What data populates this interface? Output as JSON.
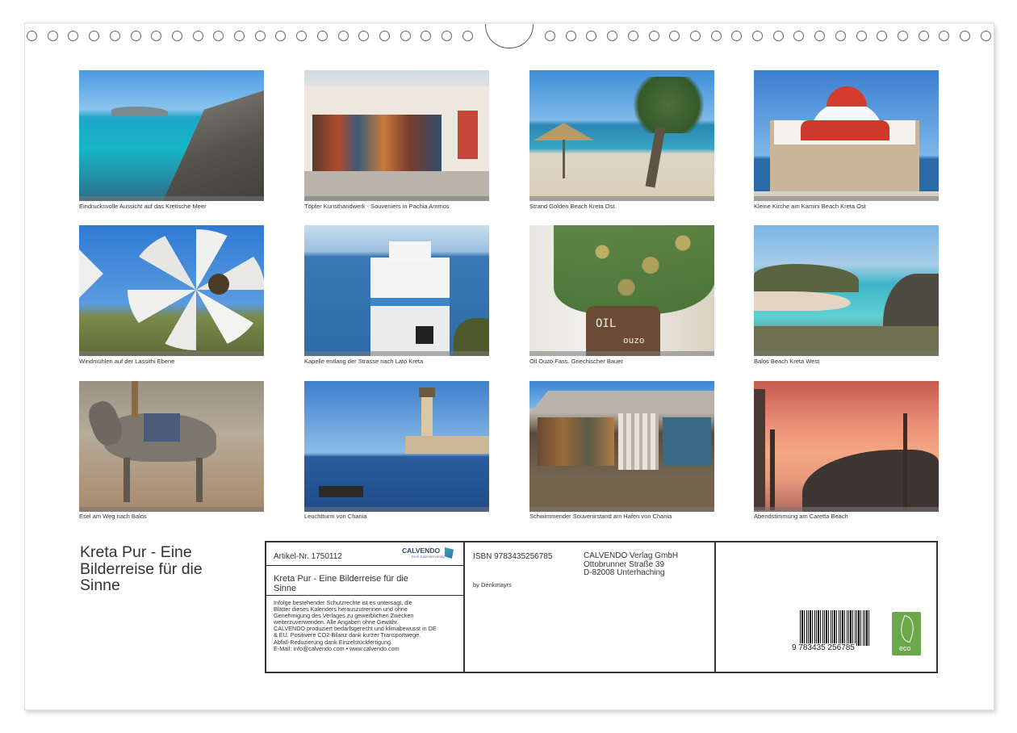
{
  "photos": [
    {
      "caption": "Eindrucksvolle Aussicht auf das Kretische Meer"
    },
    {
      "caption": "Töpfer Kunsthandwerk - Souveniers in Pachia Ammos"
    },
    {
      "caption": "Strand Golden Beach Kreta Ost"
    },
    {
      "caption": "Kleine Kirche am Kamini Beach Kreta Ost"
    },
    {
      "caption": "Windmühlen auf der Lassithi Ebene"
    },
    {
      "caption": "Kapelle entlang der Strasse nach Lato Kreta"
    },
    {
      "caption": "Oil Ouzo Fass. Griechischer Bauer",
      "sign_line1": "OIL",
      "sign_line2": "ouzo"
    },
    {
      "caption": "Balos Beach Kreta West"
    },
    {
      "caption": "Esel am Weg nach Balos"
    },
    {
      "caption": "Leuchtturm von Chania"
    },
    {
      "caption": "Schwimmender Souvenirstand am Hafen von Chania"
    },
    {
      "caption": "Abendstimmung am Caretta Beach"
    }
  ],
  "title": {
    "line1": "Kreta Pur - Eine",
    "line2": "Bilderreise für die",
    "line3": "Sinne"
  },
  "info": {
    "article_no": "Artikel-Nr. 1750112",
    "brand": "CALVENDO",
    "brand_sub": "Dein Kalenderverlag",
    "product_title_line1": "Kreta Pur - Eine Bilderreise für die",
    "product_title_line2": "Sinne",
    "legal": [
      "Infolge bestehender Schutzrechte ist es untersagt, die",
      "Blätter dieses Kalenders herauszutrennen und ohne",
      "Genehmigung des Verlages zu gewerblichen Zwecken",
      "weiterzuverwenden. Alle Angaben ohne Gewähr.",
      "CALVENDO produziert bedarfsgerecht und klimabewusst in DE",
      "& EU. Positivere CO2-Bilanz dank kurzer Transportwege.",
      "Abfall-Reduzierung dank Einzelstückfertigung.",
      "E-Mail: info@calvendo.com • www.calvendo.com"
    ],
    "isbn": "ISBN 9783435256785",
    "author": "by Denkmayrs",
    "publisher_line1": "CALVENDO Verlag GmbH",
    "publisher_line2": "Ottobrunner Straße 39",
    "publisher_line3": "D-82008 Unterhaching",
    "barcode_digits": "9 783435 256785",
    "eco_label": "eco"
  }
}
